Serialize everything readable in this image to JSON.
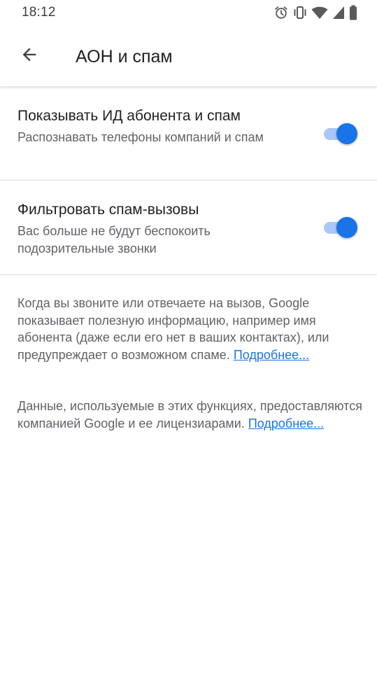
{
  "status_bar": {
    "time": "18:12",
    "icons": [
      "alarm-icon",
      "vibrate-icon",
      "wifi-icon",
      "signal-icon",
      "battery-icon"
    ]
  },
  "app_bar": {
    "back_icon": "arrow-back-icon",
    "title": "АОН и спам"
  },
  "settings": [
    {
      "title": "Показывать ИД абонента и спам",
      "subtitle": "Распознавать телефоны компаний и спам",
      "enabled": true
    },
    {
      "title": "Фильтровать спам-вызовы",
      "subtitle": "Вас больше не будут беспокоить подозрительные звонки",
      "enabled": true
    }
  ],
  "info": [
    {
      "text": "Когда вы звоните или отвечаете на вызов, Google показывает полезную информацию, например имя абонента (даже если его нет в ваших контактах), или предупреждает о возможном спаме.",
      "link": "Подробнее..."
    },
    {
      "text": "Данные, используемые в этих функциях, предоставляются компанией Google и ее лицензиарами.",
      "link": "Подробнее..."
    }
  ],
  "colors": {
    "accent": "#1a73e8",
    "toggle_track": "#a9c8f7",
    "primary_text": "#202124",
    "secondary_text": "#5f6368",
    "divider": "#dadce0"
  }
}
